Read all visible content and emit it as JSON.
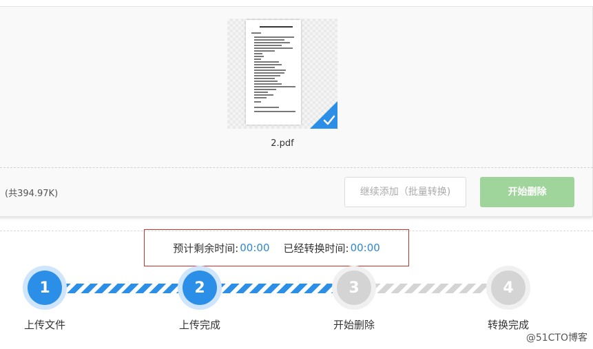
{
  "file": {
    "name": "2.pdf"
  },
  "summary": {
    "total_size": "(共394.97K)"
  },
  "buttons": {
    "continue_add": "继续添加（批量转换)",
    "start_delete": "开始删除"
  },
  "timing": {
    "remaining_label": "预计剩余时间:",
    "remaining_value": "00:00",
    "elapsed_label": "已经转换时间:",
    "elapsed_value": "00:00"
  },
  "steps": [
    {
      "number": "1",
      "label": "上传文件",
      "state": "active"
    },
    {
      "number": "2",
      "label": "上传完成",
      "state": "active"
    },
    {
      "number": "3",
      "label": "开始删除",
      "state": "idle"
    },
    {
      "number": "4",
      "label": "转换完成",
      "state": "idle"
    }
  ],
  "colors": {
    "accent_blue": "#2b8fe8",
    "start_button_green": "#9fd49b",
    "time_box_border": "#c9302c",
    "idle_grey": "#d4d4d4"
  },
  "icons": {
    "selected_check": "check-icon"
  },
  "watermark": "@51CTO博客"
}
